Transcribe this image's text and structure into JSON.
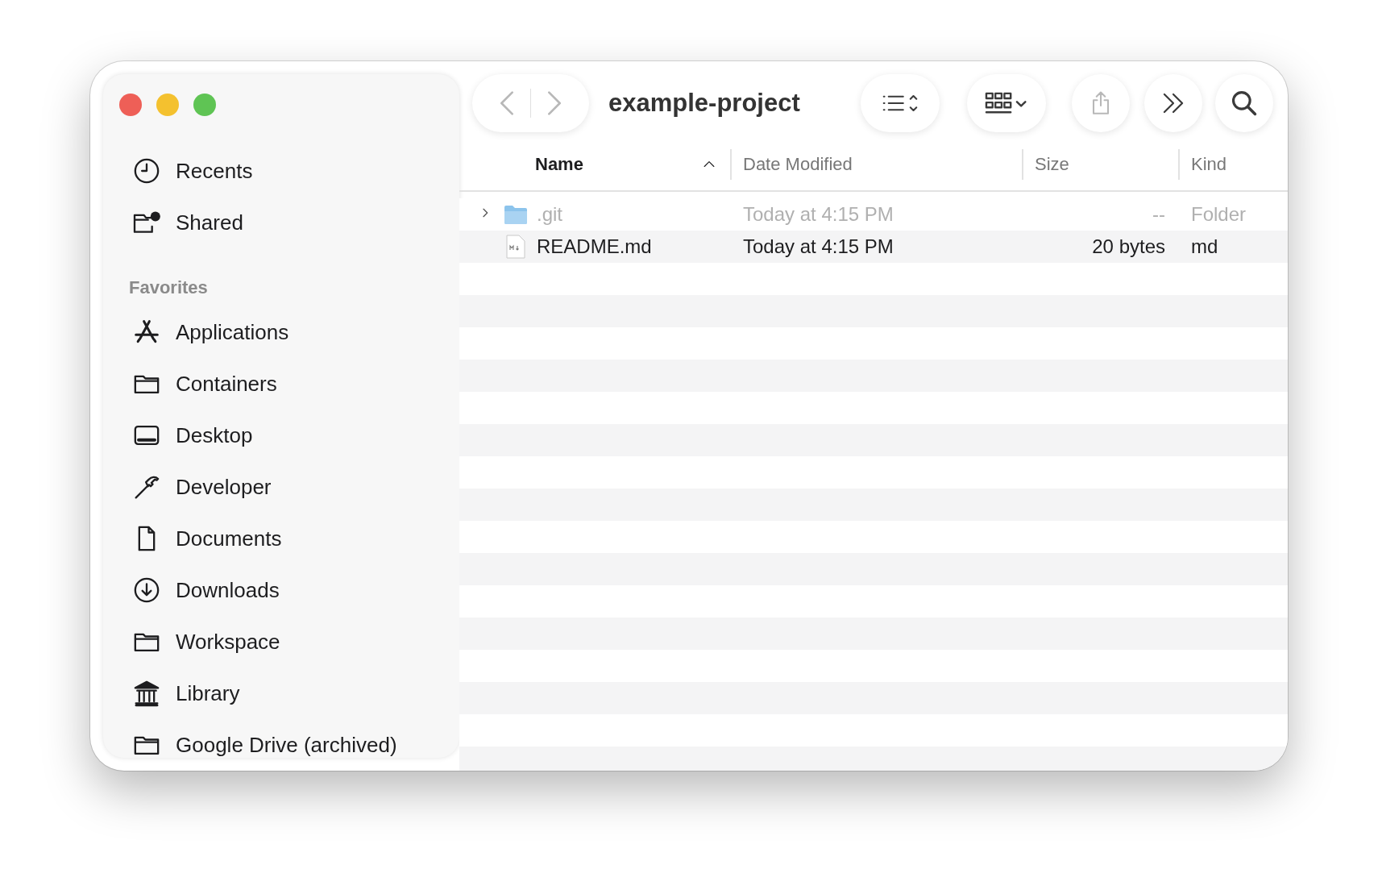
{
  "window": {
    "title": "example-project"
  },
  "toolbar": {
    "buttons": [
      {
        "kind": "back",
        "disabled": true
      },
      {
        "kind": "forward",
        "disabled": true
      },
      {
        "kind": "list",
        "disabled": false
      },
      {
        "kind": "grid",
        "disabled": false
      },
      {
        "kind": "share",
        "disabled": true
      },
      {
        "kind": "more",
        "disabled": false
      },
      {
        "kind": "search",
        "disabled": false
      }
    ]
  },
  "sidebar": {
    "top_items": [
      {
        "label": "Recents",
        "kind": "clock"
      },
      {
        "label": "Shared",
        "kind": "shared"
      }
    ],
    "sections": [
      {
        "title": "Favorites",
        "items": [
          {
            "label": "Applications",
            "kind": "apps"
          },
          {
            "label": "Containers",
            "kind": "folder"
          },
          {
            "label": "Desktop",
            "kind": "desktop"
          },
          {
            "label": "Developer",
            "kind": "hammer"
          },
          {
            "label": "Documents",
            "kind": "document"
          },
          {
            "label": "Downloads",
            "kind": "download"
          },
          {
            "label": "Workspace",
            "kind": "folder"
          },
          {
            "label": "Library",
            "kind": "library"
          },
          {
            "label": "Google Drive (archived)",
            "kind": "folder"
          }
        ]
      }
    ]
  },
  "table": {
    "columns": [
      {
        "label": "Name",
        "sorted": true
      },
      {
        "label": "Date Modified",
        "sorted": false
      },
      {
        "label": "Size",
        "sorted": false
      },
      {
        "label": "Kind",
        "sorted": false
      }
    ],
    "rows": [
      {
        "name": ".git",
        "folder": true,
        "expanded": false,
        "dimmed": true,
        "date": "Today at 4:15 PM",
        "size": "--",
        "kind": "Folder"
      },
      {
        "name": "README.md",
        "folder": false,
        "dimmed": false,
        "date": "Today at 4:15 PM",
        "size": "20 bytes",
        "kind": "md"
      }
    ]
  }
}
